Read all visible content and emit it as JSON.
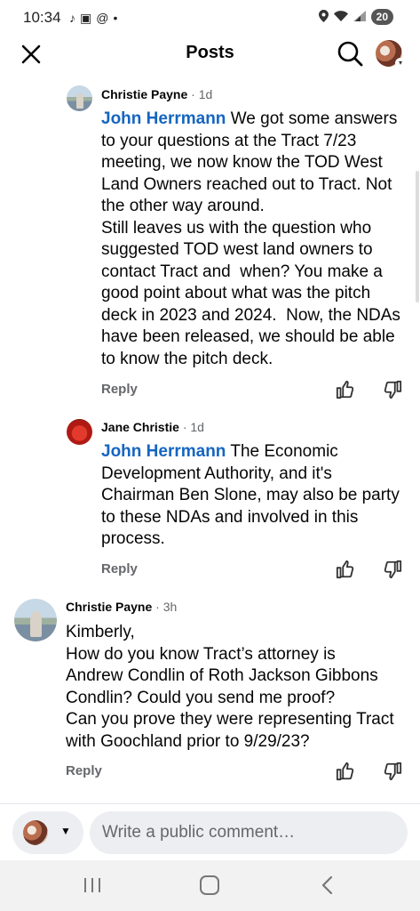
{
  "status_bar": {
    "time": "10:34",
    "left_icons": [
      "tiktok-icon",
      "screenshot-icon",
      "threads-icon",
      "dot-icon"
    ],
    "right_icons": [
      "location-icon",
      "wifi-icon",
      "signal-icon"
    ],
    "battery": "20"
  },
  "header": {
    "title": "Posts"
  },
  "comments": [
    {
      "author": "Christie Payne",
      "time": "· 1d",
      "mention": "John Herrmann",
      "text": " We got some answers\nto your questions at the Tract 7/23\nmeeting, we now know the TOD West\nLand Owners reached out to Tract. Not\nthe other way around.\nStill leaves us with the question who\nsuggested TOD west land owners to\ncontact Tract and  when? You make a\ngood point about what was the pitch\ndeck in 2023 and 2024.  Now, the NDAs\nhave been released, we should be able\nto know the pitch deck.",
      "reply_label": "Reply"
    },
    {
      "author": "Jane Christie",
      "time": "· 1d",
      "mention": "John Herrmann",
      "text": " The Economic\nDevelopment Authority, and it's\nChairman Ben Slone, may also be party\nto these NDAs and involved in this\nprocess.",
      "reply_label": "Reply"
    },
    {
      "author": "Christie Payne",
      "time": "· 3h",
      "mention": "",
      "text": "Kimberly,\nHow do you know Tract’s attorney is\nAndrew Condlin of Roth Jackson Gibbons\nCondlin? Could you send me proof?\nCan you prove they were representing Tract\nwith Goochland prior to 9/29/23?",
      "reply_label": "Reply"
    }
  ],
  "composer": {
    "placeholder": "Write a public comment…"
  },
  "colors": {
    "mention": "#1565c0",
    "secondary_text": "#65676b",
    "input_bg": "#eceef1"
  }
}
